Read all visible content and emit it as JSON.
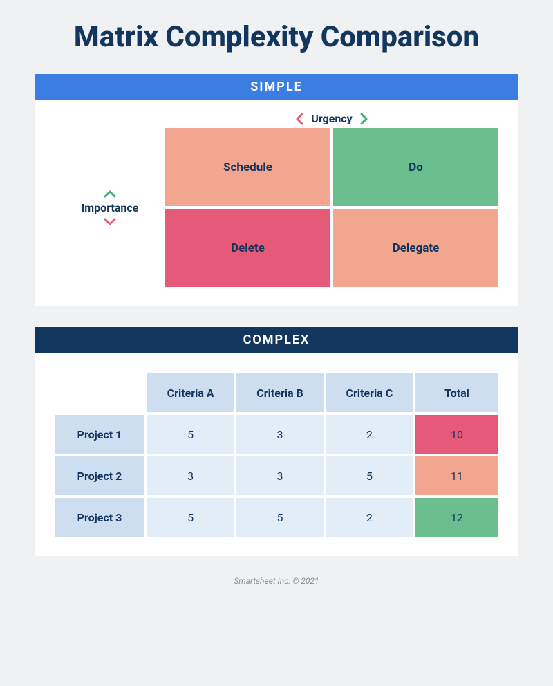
{
  "title": "Matrix Complexity Comparison",
  "simple": {
    "header": "SIMPLE",
    "axis_x": "Urgency",
    "axis_y": "Importance",
    "quadrants": {
      "top_left": "Schedule",
      "top_right": "Do",
      "bottom_left": "Delete",
      "bottom_right": "Delegate"
    }
  },
  "complex": {
    "header": "COMPLEX",
    "columns": [
      "Criteria A",
      "Criteria B",
      "Criteria C",
      "Total"
    ],
    "rows": [
      {
        "label": "Project 1",
        "values": [
          "5",
          "3",
          "2"
        ],
        "total": "10",
        "total_color": "pink"
      },
      {
        "label": "Project 2",
        "values": [
          "3",
          "3",
          "5"
        ],
        "total": "11",
        "total_color": "peach"
      },
      {
        "label": "Project 3",
        "values": [
          "5",
          "5",
          "2"
        ],
        "total": "12",
        "total_color": "green"
      }
    ]
  },
  "footer": "Smartsheet Inc. © 2021",
  "colors": {
    "navy": "#13365f",
    "blue": "#3b7de0",
    "peach": "#f2a58f",
    "green": "#6bbf8f",
    "pink": "#e45a78",
    "lightblue": "#cddef0",
    "paleblue": "#e3edf7"
  }
}
